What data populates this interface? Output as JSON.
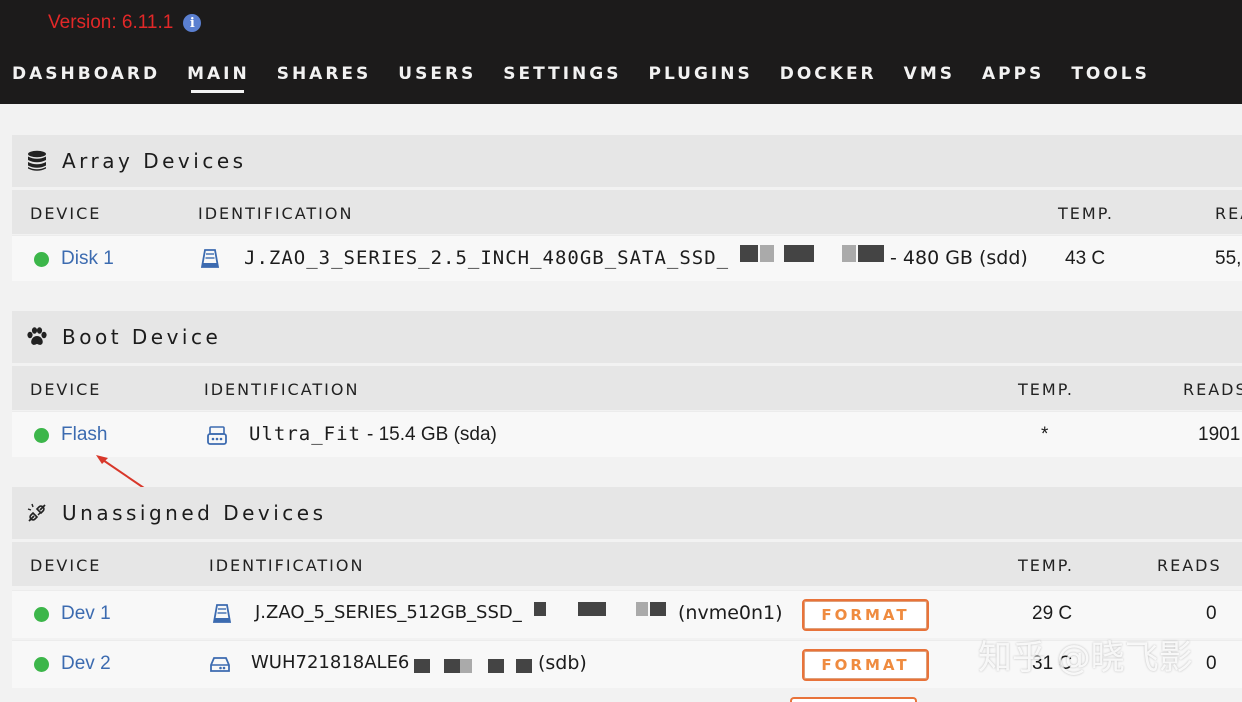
{
  "header": {
    "version": "Version: 6.11.1",
    "nav": [
      "DASHBOARD",
      "MAIN",
      "SHARES",
      "USERS",
      "SETTINGS",
      "PLUGINS",
      "DOCKER",
      "VMS",
      "APPS",
      "TOOLS"
    ],
    "active_nav": "MAIN"
  },
  "array": {
    "title": "Array Devices",
    "columns": {
      "device": "DEVICE",
      "identification": "IDENTIFICATION",
      "temp": "TEMP.",
      "reads": "REA"
    },
    "rows": [
      {
        "device": "Disk 1",
        "id_name": "J.ZAO_3_SERIES_2.5_INCH_480GB_SATA_SSD_",
        "id_suffix": "- 480 GB (sdd)",
        "temp": "43 C",
        "reads": "55,"
      }
    ]
  },
  "boot": {
    "title": "Boot Device",
    "columns": {
      "device": "DEVICE",
      "identification": "IDENTIFICATION",
      "temp": "TEMP.",
      "reads": "READS"
    },
    "rows": [
      {
        "device": "Flash",
        "id_name": "Ultra_Fit",
        "id_suffix": "- 15.4 GB (sda)",
        "temp": "*",
        "reads": "1901"
      }
    ]
  },
  "unassigned": {
    "title": "Unassigned Devices",
    "columns": {
      "device": "DEVICE",
      "identification": "IDENTIFICATION",
      "temp": "TEMP.",
      "reads": "READS"
    },
    "rows": [
      {
        "device": "Dev 1",
        "id_name": "J.ZAO_5_SERIES_512GB_SSD_",
        "id_suffix": "(nvme0n1)",
        "button": "FORMAT",
        "temp": "29 C",
        "reads": "0"
      },
      {
        "device": "Dev 2",
        "id_name": "WUH721818ALE6",
        "id_suffix": "(sdb)",
        "button": "FORMAT",
        "temp": "31 C",
        "reads": "0"
      }
    ]
  },
  "watermark": "知乎 @晓飞影",
  "colors": {
    "header_bg": "#1c1b1b",
    "version_red": "#e22828",
    "link_blue": "#3c6bb0",
    "status_green": "#3cb64a",
    "format_orange": "#ef8b3f"
  }
}
